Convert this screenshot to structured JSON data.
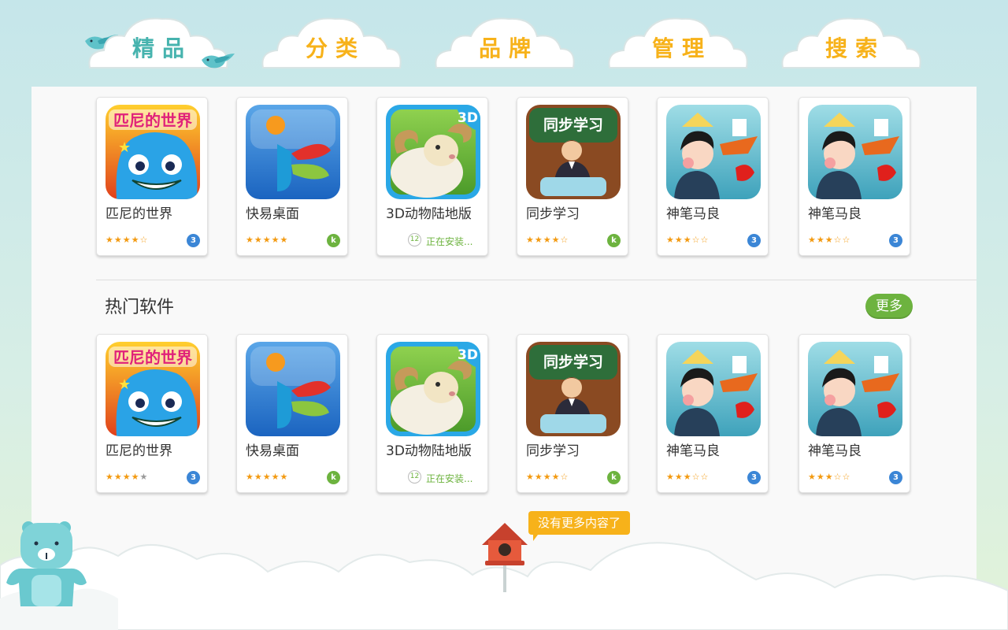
{
  "tabs": [
    {
      "label": "精品",
      "active": true
    },
    {
      "label": "分类",
      "active": false
    },
    {
      "label": "品牌",
      "active": false
    },
    {
      "label": "管理",
      "active": false
    },
    {
      "label": "搜索",
      "active": false
    }
  ],
  "featured_apps": [
    {
      "name": "匹尼的世界",
      "stars": "★★★★☆",
      "badge": "3",
      "icon": "pini-world-icon"
    },
    {
      "name": "快易桌面",
      "stars": "★★★★★",
      "badge": "k",
      "icon": "kuaiyi-desktop-icon"
    },
    {
      "name": "3D动物陆地版",
      "status": "正在安装...",
      "progress_label": "12",
      "icon": "3d-sheep-icon"
    },
    {
      "name": "同步学习",
      "stars": "★★★★☆",
      "badge": "k",
      "icon": "tongbu-xuexi-icon"
    },
    {
      "name": "神笔马良",
      "stars": "★★★☆☆",
      "badge": "3",
      "icon": "shenbi-maliang-icon"
    },
    {
      "name": "神笔马良",
      "stars": "★★★☆☆",
      "badge": "3",
      "icon": "shenbi-maliang-icon"
    }
  ],
  "hot_section": {
    "title": "热门软件",
    "more_label": "更多"
  },
  "hot_apps": [
    {
      "name": "匹尼的世界",
      "stars": "★★★★★",
      "badge": "3",
      "icon": "pini-world-icon"
    },
    {
      "name": "快易桌面",
      "stars": "★★★★★",
      "badge": "k",
      "icon": "kuaiyi-desktop-icon"
    },
    {
      "name": "3D动物陆地版",
      "status": "正在安装...",
      "progress_label": "12",
      "icon": "3d-sheep-icon"
    },
    {
      "name": "同步学习",
      "stars": "★★★★☆",
      "badge": "k",
      "icon": "tongbu-xuexi-icon"
    },
    {
      "name": "神笔马良",
      "stars": "★★★☆☆",
      "badge": "3",
      "icon": "shenbi-maliang-icon"
    },
    {
      "name": "神笔马良",
      "stars": "★★★☆☆",
      "badge": "3",
      "icon": "shenbi-maliang-icon"
    }
  ],
  "footer": {
    "no_more_text": "没有更多内容了"
  },
  "icon_texts": {
    "pini": "匹尼的世界",
    "tongbu": "同步学习",
    "threeD": "3D"
  },
  "colors": {
    "accent_yellow": "#f7b21a",
    "active_teal": "#46b3ae",
    "green": "#6db33f",
    "badge_blue": "#3b86d6",
    "star_orange": "#f39a11"
  }
}
